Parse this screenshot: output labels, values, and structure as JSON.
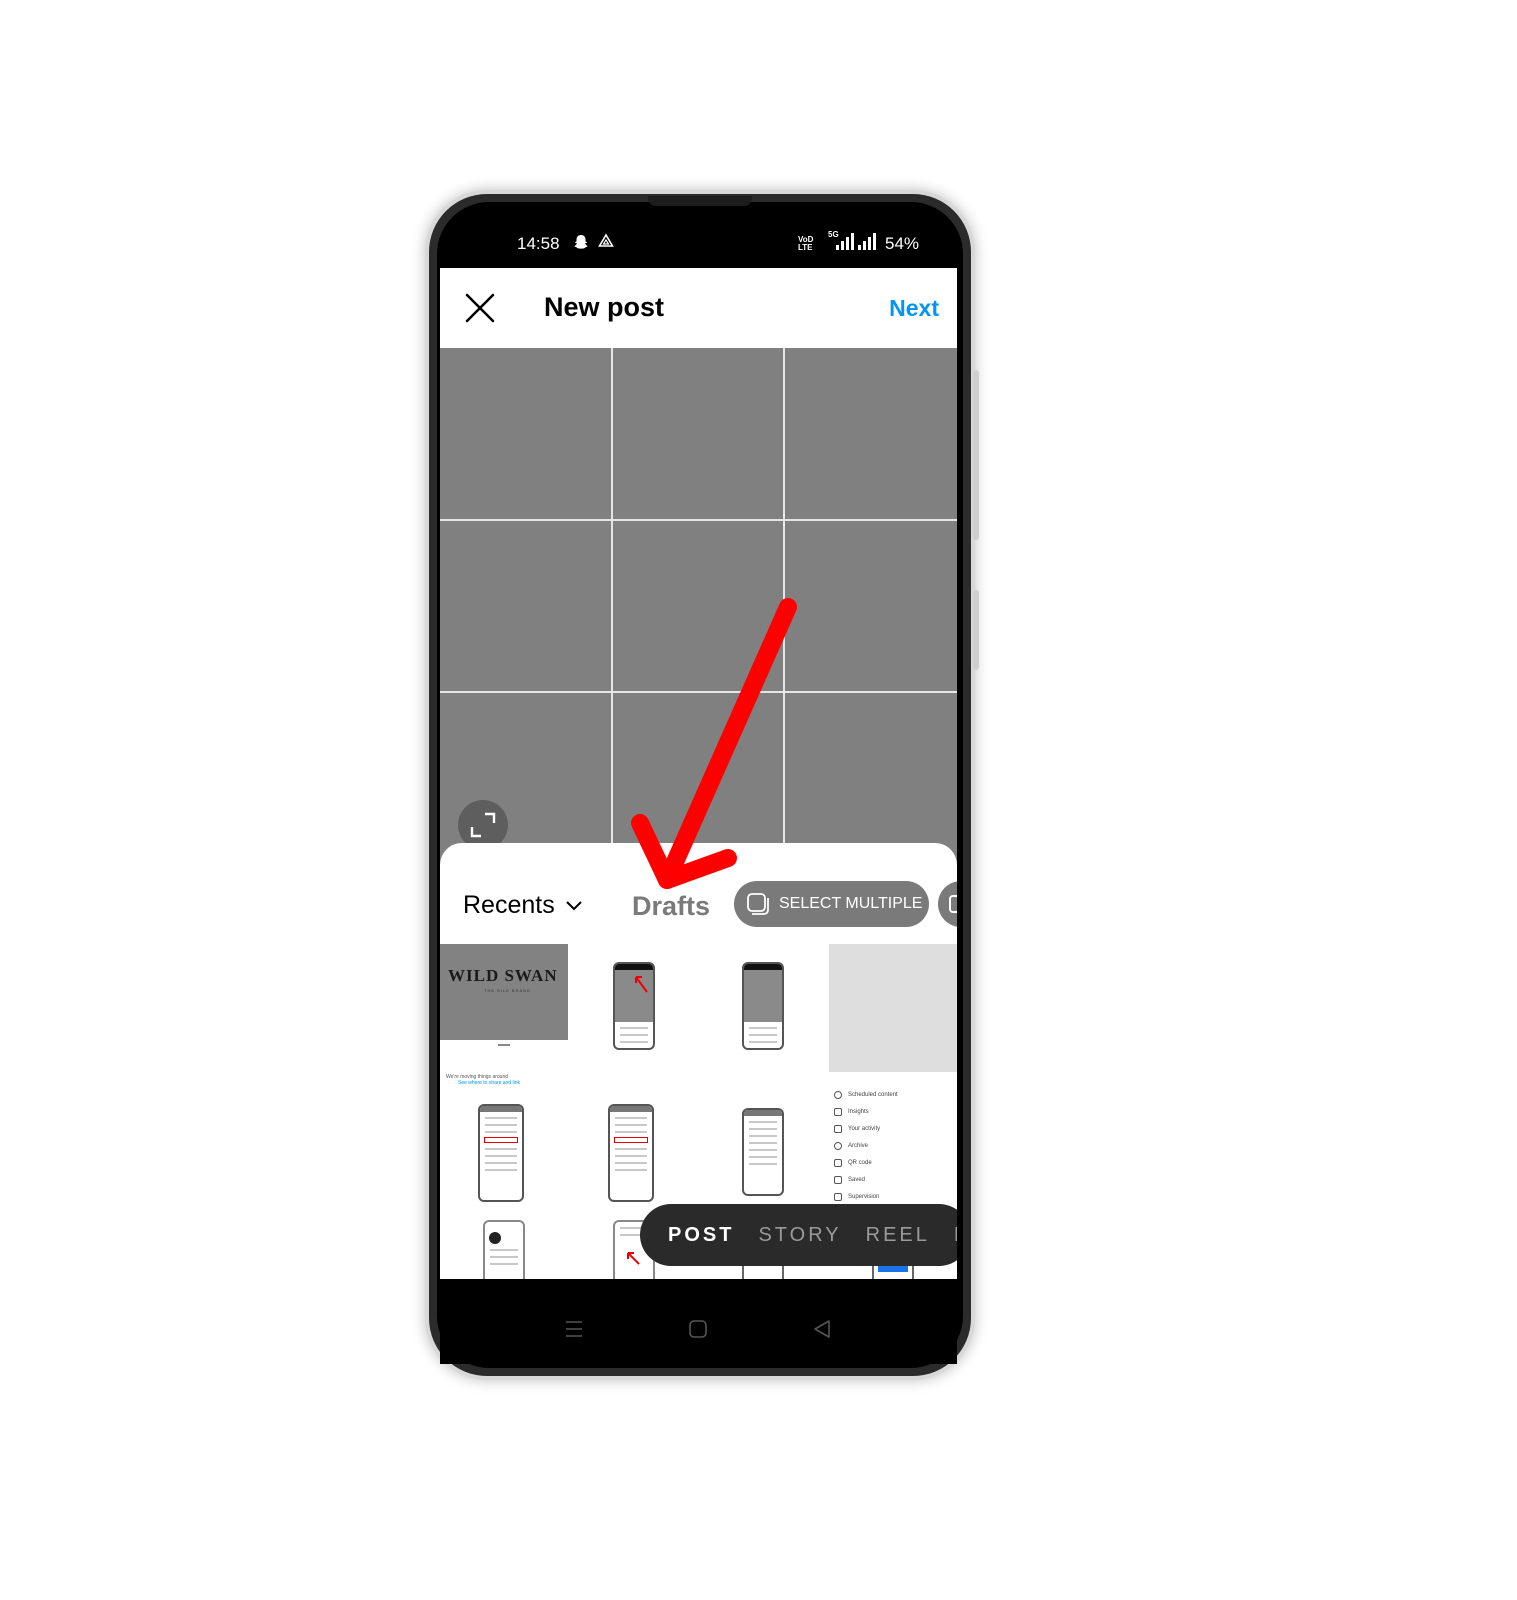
{
  "status_bar": {
    "time": "14:58",
    "notification_icons": [
      "snapchat-icon",
      "drive-icon"
    ],
    "volte_label": "VoD LTE",
    "network_label": "5G",
    "battery": "54%"
  },
  "header": {
    "title": "New post",
    "close_icon": "close-icon",
    "next_label": "Next",
    "accent_color": "#0095f6"
  },
  "preview": {
    "background_color": "#808080",
    "grid": "3x3",
    "expand_icon": "expand-icon"
  },
  "gallery": {
    "album_label": "Recents",
    "drafts_label": "Drafts",
    "select_multiple_label": "SELECT MULTIPLE",
    "thumbnails": [
      {
        "type": "image",
        "title": "WILD SWAN",
        "subtitle": "THE SILK BRAND"
      },
      {
        "type": "screenshot",
        "desc": "phone screenshot with red arrow"
      },
      {
        "type": "screenshot",
        "desc": "phone screenshot"
      },
      {
        "type": "screenshot",
        "desc": "light gray preview"
      },
      {
        "type": "banner",
        "text": "We're moving things around",
        "link": "See where to share and link"
      },
      {
        "type": "screenshot",
        "desc": "menu with highlighted item"
      },
      {
        "type": "screenshot",
        "desc": "menu list"
      },
      {
        "type": "menu",
        "items": [
          "Scheduled content",
          "Insights",
          "Your activity",
          "Archive",
          "QR code",
          "Saved",
          "Supervision"
        ]
      },
      {
        "type": "screenshot",
        "desc": "profile screenshot"
      },
      {
        "type": "screenshot",
        "desc": "screenshot with red arrow"
      },
      {
        "type": "screenshot",
        "desc": "screenshot"
      },
      {
        "type": "screenshot",
        "desc": "screenshot with blue button"
      }
    ]
  },
  "mode_bar": {
    "modes": [
      "POST",
      "STORY",
      "REEL",
      "LIVE"
    ],
    "active": "POST"
  },
  "nav_bar": {
    "buttons": [
      "menu-icon",
      "home-icon",
      "back-icon"
    ]
  },
  "annotation": {
    "type": "arrow",
    "color": "#ff0000",
    "points_to": "Drafts"
  }
}
